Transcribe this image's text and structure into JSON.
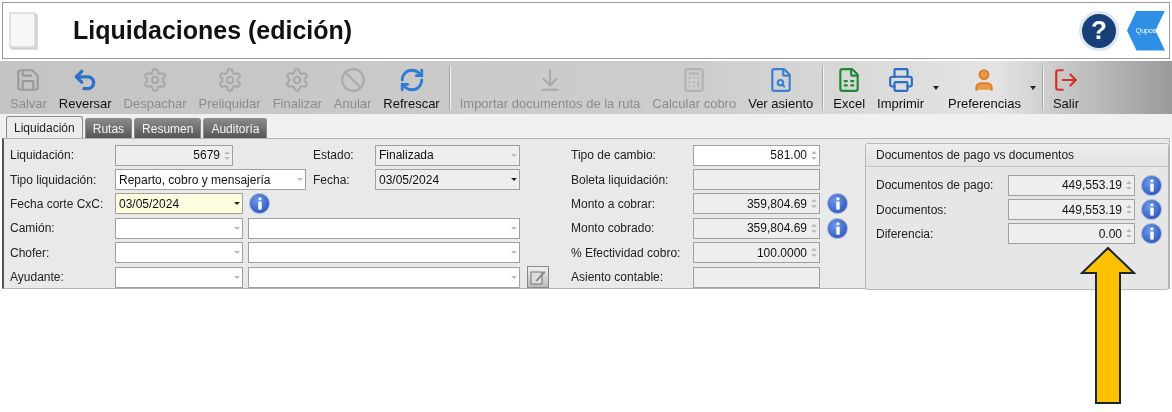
{
  "header": {
    "title": "Liquidaciones (edición)",
    "help_label": "?",
    "logo_text": "Qupos"
  },
  "toolbar": [
    {
      "label": "Salvar",
      "disabled": true,
      "dropdown": false,
      "separator_after": false
    },
    {
      "label": "Reversar",
      "disabled": false,
      "dropdown": false,
      "separator_after": false
    },
    {
      "label": "Despachar",
      "disabled": true,
      "dropdown": false,
      "separator_after": false
    },
    {
      "label": "Preliquidar",
      "disabled": true,
      "dropdown": false,
      "separator_after": false
    },
    {
      "label": "Finalizar",
      "disabled": true,
      "dropdown": false,
      "separator_after": false
    },
    {
      "label": "Anular",
      "disabled": true,
      "dropdown": false,
      "separator_after": false
    },
    {
      "label": "Refrescar",
      "disabled": false,
      "dropdown": false,
      "separator_after": true
    },
    {
      "label": "Importar documentos de la ruta",
      "disabled": true,
      "dropdown": false,
      "separator_after": false
    },
    {
      "label": "Calcular cobro",
      "disabled": true,
      "dropdown": false,
      "separator_after": false
    },
    {
      "label": "Ver asiento",
      "disabled": false,
      "dropdown": false,
      "separator_after": true
    },
    {
      "label": "Excel",
      "disabled": false,
      "dropdown": false,
      "separator_after": false
    },
    {
      "label": "Imprimir",
      "disabled": false,
      "dropdown": true,
      "separator_after": false
    },
    {
      "label": "Preferencias",
      "disabled": false,
      "dropdown": true,
      "separator_after": true
    },
    {
      "label": "Salir",
      "disabled": false,
      "dropdown": false,
      "separator_after": false
    }
  ],
  "tabs": [
    {
      "label": "Liquidación",
      "selected": true
    },
    {
      "label": "Rutas",
      "selected": false
    },
    {
      "label": "Resumen",
      "selected": false
    },
    {
      "label": "Auditoría",
      "selected": false
    }
  ],
  "left_fields": [
    {
      "label": "Liquidación:",
      "kind": "spin",
      "value": "5679",
      "readonly": true,
      "highlighted": false
    },
    {
      "label": "Estado:",
      "kind": "combo",
      "value": "Finalizada",
      "readonly": true,
      "highlighted": false
    },
    {
      "label": "Tipo liquidación:",
      "kind": "combo",
      "value": "Reparto, cobro y mensajería",
      "readonly": false,
      "highlighted": false
    },
    {
      "label": "Fecha:",
      "kind": "date",
      "value": "03/05/2024",
      "readonly": true,
      "highlighted": false
    },
    {
      "label": "Fecha corte CxC:",
      "kind": "date",
      "value": "03/05/2024",
      "readonly": false,
      "highlighted": true,
      "info": true
    },
    {
      "label": "Camión:",
      "kind": "combo_pair",
      "readonly": false,
      "highlighted": false,
      "edit_button": false
    },
    {
      "label": "Chofer:",
      "kind": "combo_pair",
      "readonly": false,
      "highlighted": false,
      "edit_button": false
    },
    {
      "label": "Ayudante:",
      "kind": "combo_pair",
      "readonly": false,
      "highlighted": false,
      "edit_button": true
    }
  ],
  "middle_fields": [
    {
      "label": "Tipo de cambio:",
      "kind": "spin",
      "value": "581.00",
      "readonly": false,
      "info": false
    },
    {
      "label": "Boleta liquidación:",
      "kind": "text",
      "readonly": true,
      "info": false
    },
    {
      "label": "Monto a cobrar:",
      "kind": "spin",
      "value": "359,804.69",
      "readonly": true,
      "info": true
    },
    {
      "label": "Monto cobrado:",
      "kind": "spin",
      "value": "359,804.69",
      "readonly": true,
      "info": true
    },
    {
      "label": "% Efectividad cobro:",
      "kind": "spin",
      "value": "100.0000",
      "readonly": true,
      "info": false
    },
    {
      "label": "Asiento contable:",
      "kind": "text",
      "readonly": true,
      "info": false
    }
  ],
  "group": {
    "title": "Documentos de pago vs documentos",
    "fields": [
      {
        "label": "Documentos de pago:",
        "kind": "spin",
        "value": "449,553.19",
        "readonly": true,
        "info": true
      },
      {
        "label": "Documentos:",
        "kind": "spin",
        "value": "449,553.19",
        "readonly": true,
        "info": true
      },
      {
        "label": "Diferencia:",
        "kind": "spin",
        "value": "0.00",
        "readonly": true,
        "info": true
      }
    ]
  }
}
